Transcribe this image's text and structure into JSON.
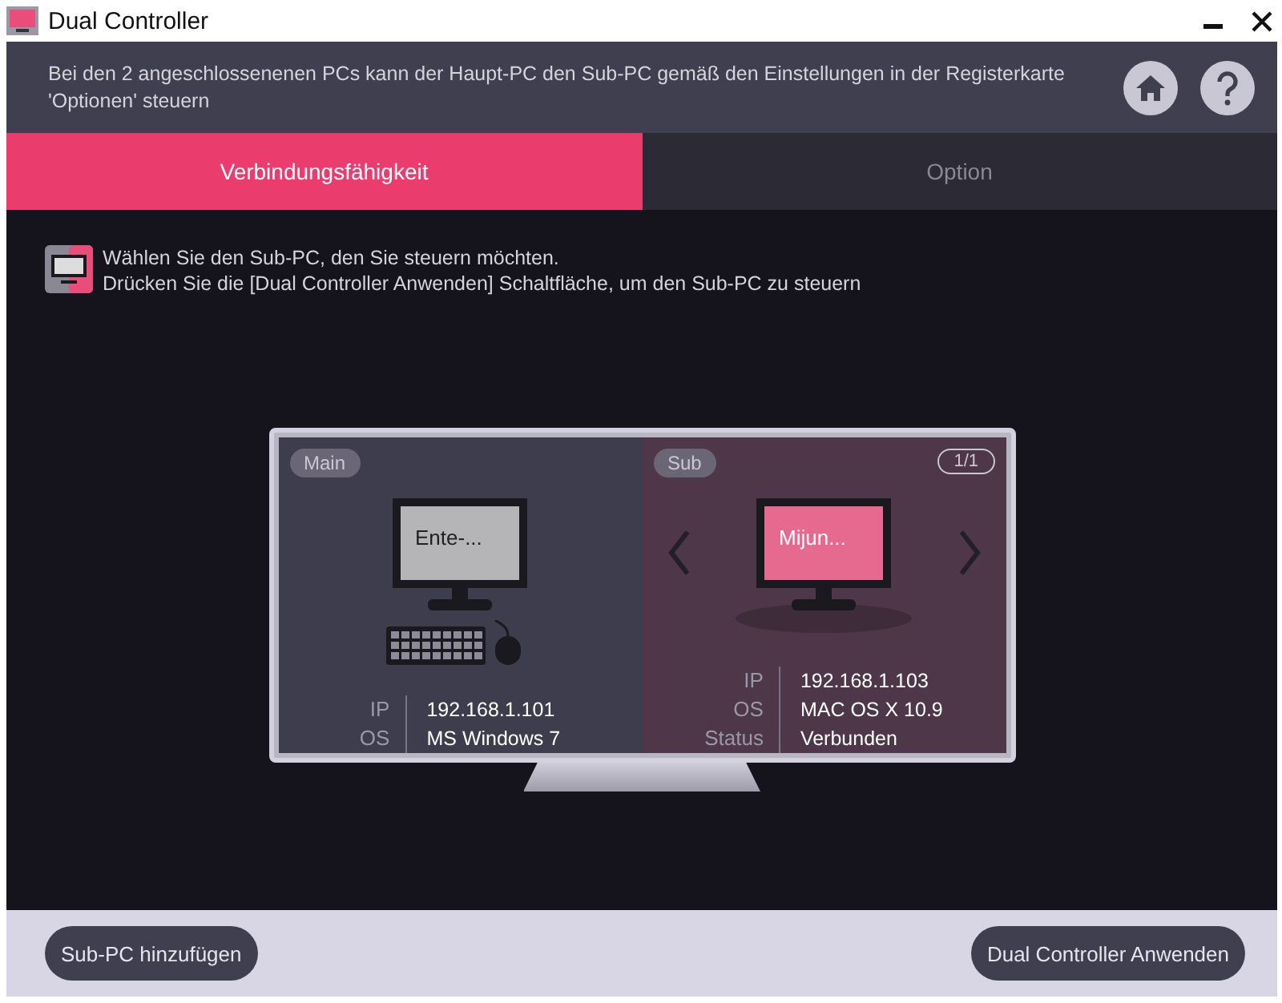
{
  "window": {
    "title": "Dual Controller"
  },
  "header": {
    "text": "Bei den 2 angeschlossenenen PCs kann der Haupt-PC den Sub-PC gemäß den Einstellungen in der Registerkarte 'Optionen' steuern"
  },
  "tabs": [
    {
      "label": "Verbindungsfähigkeit",
      "selected": true
    },
    {
      "label": "Option",
      "selected": false
    }
  ],
  "instructions": [
    "Wählen Sie den Sub-PC, den Sie steuern möchten.",
    "Drücken Sie die [Dual Controller Anwenden] Schaltfläche, um den Sub-PC zu steuern"
  ],
  "main": {
    "badge": "Main",
    "screen_label": "Ente-...",
    "fields": [
      {
        "label": "IP",
        "value": "192.168.1.101"
      },
      {
        "label": "OS",
        "value": "MS Windows 7"
      }
    ]
  },
  "sub": {
    "badge": "Sub",
    "page": "1/1",
    "screen_label": "Mijun...",
    "fields": [
      {
        "label": "IP",
        "value": "192.168.1.103"
      },
      {
        "label": "OS",
        "value": "MAC OS X 10.9"
      },
      {
        "label": "Status",
        "value": "Verbunden"
      }
    ]
  },
  "footer": {
    "buttons": [
      "Sub-PC hinzufügen",
      "Dual Controller Anwenden"
    ]
  }
}
